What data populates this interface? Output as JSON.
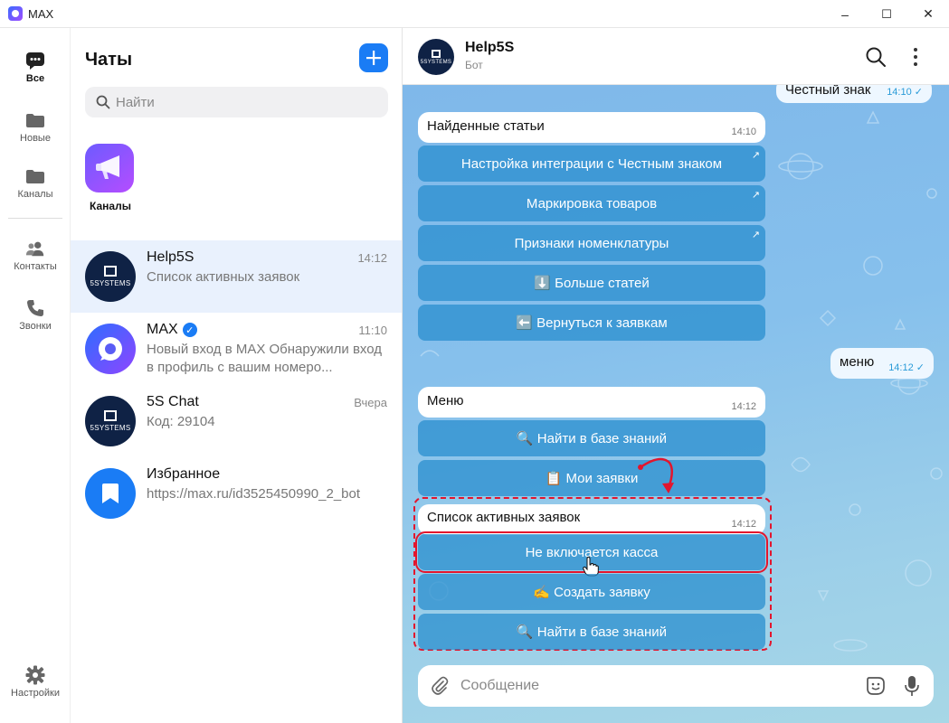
{
  "window": {
    "title": "MAX",
    "buttons": [
      "–",
      "☐",
      "✕"
    ]
  },
  "rail": {
    "items": [
      {
        "label": "Все",
        "icon": "chat-bubble-icon",
        "active": true
      },
      {
        "label": "Новые",
        "icon": "folder-icon"
      },
      {
        "label": "Каналы",
        "icon": "folder-icon"
      },
      {
        "label": "Контакты",
        "icon": "contacts-icon"
      },
      {
        "label": "Звонки",
        "icon": "phone-icon"
      }
    ],
    "settings_label": "Настройки"
  },
  "list": {
    "title": "Чаты",
    "search_placeholder": "Найти",
    "story_label": "Каналы",
    "chats": [
      {
        "name": "Help5S",
        "time": "14:12",
        "preview": "Список активных заявок",
        "avatar_text": "5SYSTEMS"
      },
      {
        "name": "MAX",
        "time": "11:10",
        "preview": "Новый вход в MAX  Обнаружили вход в профиль с вашим номеро..."
      },
      {
        "name": "5S Chat",
        "time": "Вчера",
        "preview": "Код: 29104",
        "avatar_text": "5SYSTEMS"
      },
      {
        "name": "Избранное",
        "time": "",
        "preview": "https://max.ru/id3525450990_2_bot"
      }
    ]
  },
  "conversation": {
    "name": "Help5S",
    "subtitle": "Бот",
    "avatar_text": "5SYSTEMS",
    "top_partial": {
      "text": "Честный знак",
      "time": "14:10"
    },
    "found": {
      "title": "Найденные статьи",
      "time": "14:10",
      "buttons": [
        "Настройка интеграции с Честным знаком",
        "Маркировка товаров",
        "Признаки номенклатуры",
        "⬇️ Больше статей",
        "⬅️ Вернуться к заявкам"
      ]
    },
    "menu_out": {
      "text": "меню",
      "time": "14:12"
    },
    "menu": {
      "title": "Меню",
      "time": "14:12",
      "buttons": [
        "🔍 Найти в базе знаний",
        "📋 Мои заявки"
      ]
    },
    "active": {
      "title": "Список активных заявок",
      "time": "14:12",
      "buttons": [
        "Не включается касса",
        "✍️ Создать заявку",
        "🔍 Найти в базе знаний"
      ]
    },
    "composer_placeholder": "Сообщение"
  },
  "colors": {
    "accent": "#1a7cf5",
    "highlight": "#e3152d",
    "button": "#268ccd"
  }
}
